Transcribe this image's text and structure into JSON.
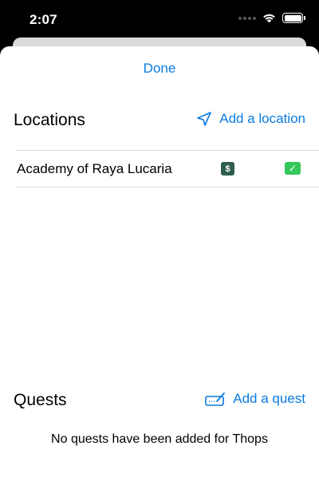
{
  "status_bar": {
    "time": "2:07",
    "icons": [
      "cellular-icon",
      "wifi-icon",
      "battery-icon"
    ]
  },
  "sheet": {
    "done_label": "Done",
    "accent_color": "#0a7ae0"
  },
  "locations": {
    "title": "Locations",
    "add_label": "Add a location",
    "add_icon": "location-arrow-icon",
    "items": [
      {
        "name": "Academy of Raya Lucaria",
        "badge_dollar": "$",
        "badge_check": "✓",
        "dollar_color": "#2f5e50",
        "check_color": "#34c759"
      }
    ]
  },
  "quests": {
    "title": "Quests",
    "add_label": "Add a quest",
    "add_icon": "signature-icon",
    "empty_text": "No quests have been added for Thops"
  }
}
